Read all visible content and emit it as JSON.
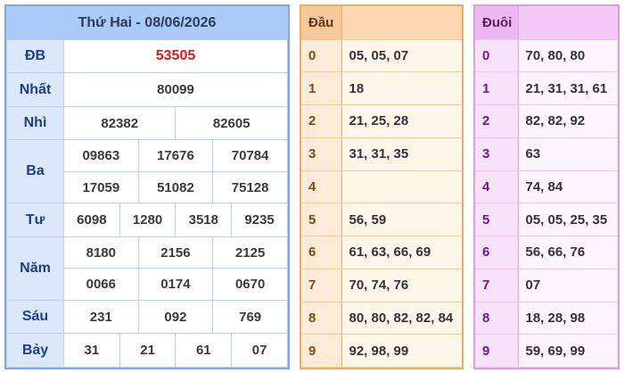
{
  "results": {
    "title": "Thứ Hai - 08/06/2026",
    "rows": [
      {
        "label": "ĐB",
        "values": [
          "53505"
        ]
      },
      {
        "label": "Nhất",
        "values": [
          "80099"
        ]
      },
      {
        "label": "Nhì",
        "values": [
          "82382",
          "82605"
        ]
      },
      {
        "label": "Ba",
        "values": [
          "09863",
          "17676",
          "70784",
          "17059",
          "51082",
          "75128"
        ]
      },
      {
        "label": "Tư",
        "values": [
          "6098",
          "1280",
          "3518",
          "9235"
        ]
      },
      {
        "label": "Năm",
        "values": [
          "8180",
          "2156",
          "2125",
          "0066",
          "0174",
          "0670"
        ]
      },
      {
        "label": "Sáu",
        "values": [
          "231",
          "092",
          "769"
        ]
      },
      {
        "label": "Bảy",
        "values": [
          "31",
          "21",
          "61",
          "07"
        ]
      }
    ]
  },
  "dau": {
    "header": "Đầu",
    "rows": [
      {
        "key": "0",
        "value": "05, 05, 07"
      },
      {
        "key": "1",
        "value": "18"
      },
      {
        "key": "2",
        "value": "21, 25, 28"
      },
      {
        "key": "3",
        "value": "31, 31, 35"
      },
      {
        "key": "4",
        "value": ""
      },
      {
        "key": "5",
        "value": "56, 59"
      },
      {
        "key": "6",
        "value": "61, 63, 66, 69"
      },
      {
        "key": "7",
        "value": "70, 74, 76"
      },
      {
        "key": "8",
        "value": "80, 80, 82, 82, 84"
      },
      {
        "key": "9",
        "value": "92, 98, 99"
      }
    ]
  },
  "duoi": {
    "header": "Đuôi",
    "rows": [
      {
        "key": "0",
        "value": "70, 80, 80"
      },
      {
        "key": "1",
        "value": "21, 31, 31, 61"
      },
      {
        "key": "2",
        "value": "82, 82, 92"
      },
      {
        "key": "3",
        "value": "63"
      },
      {
        "key": "4",
        "value": "74, 84"
      },
      {
        "key": "5",
        "value": "05, 05, 25, 35"
      },
      {
        "key": "6",
        "value": "56, 66, 76"
      },
      {
        "key": "7",
        "value": "07"
      },
      {
        "key": "8",
        "value": "18, 28, 98"
      },
      {
        "key": "9",
        "value": "59, 69, 99"
      }
    ]
  },
  "colors": {
    "special_prize": "#e8141c",
    "results_border": "#7aa7f0",
    "dau_border": "#f2ac62",
    "duoi_border": "#e09ae6"
  }
}
